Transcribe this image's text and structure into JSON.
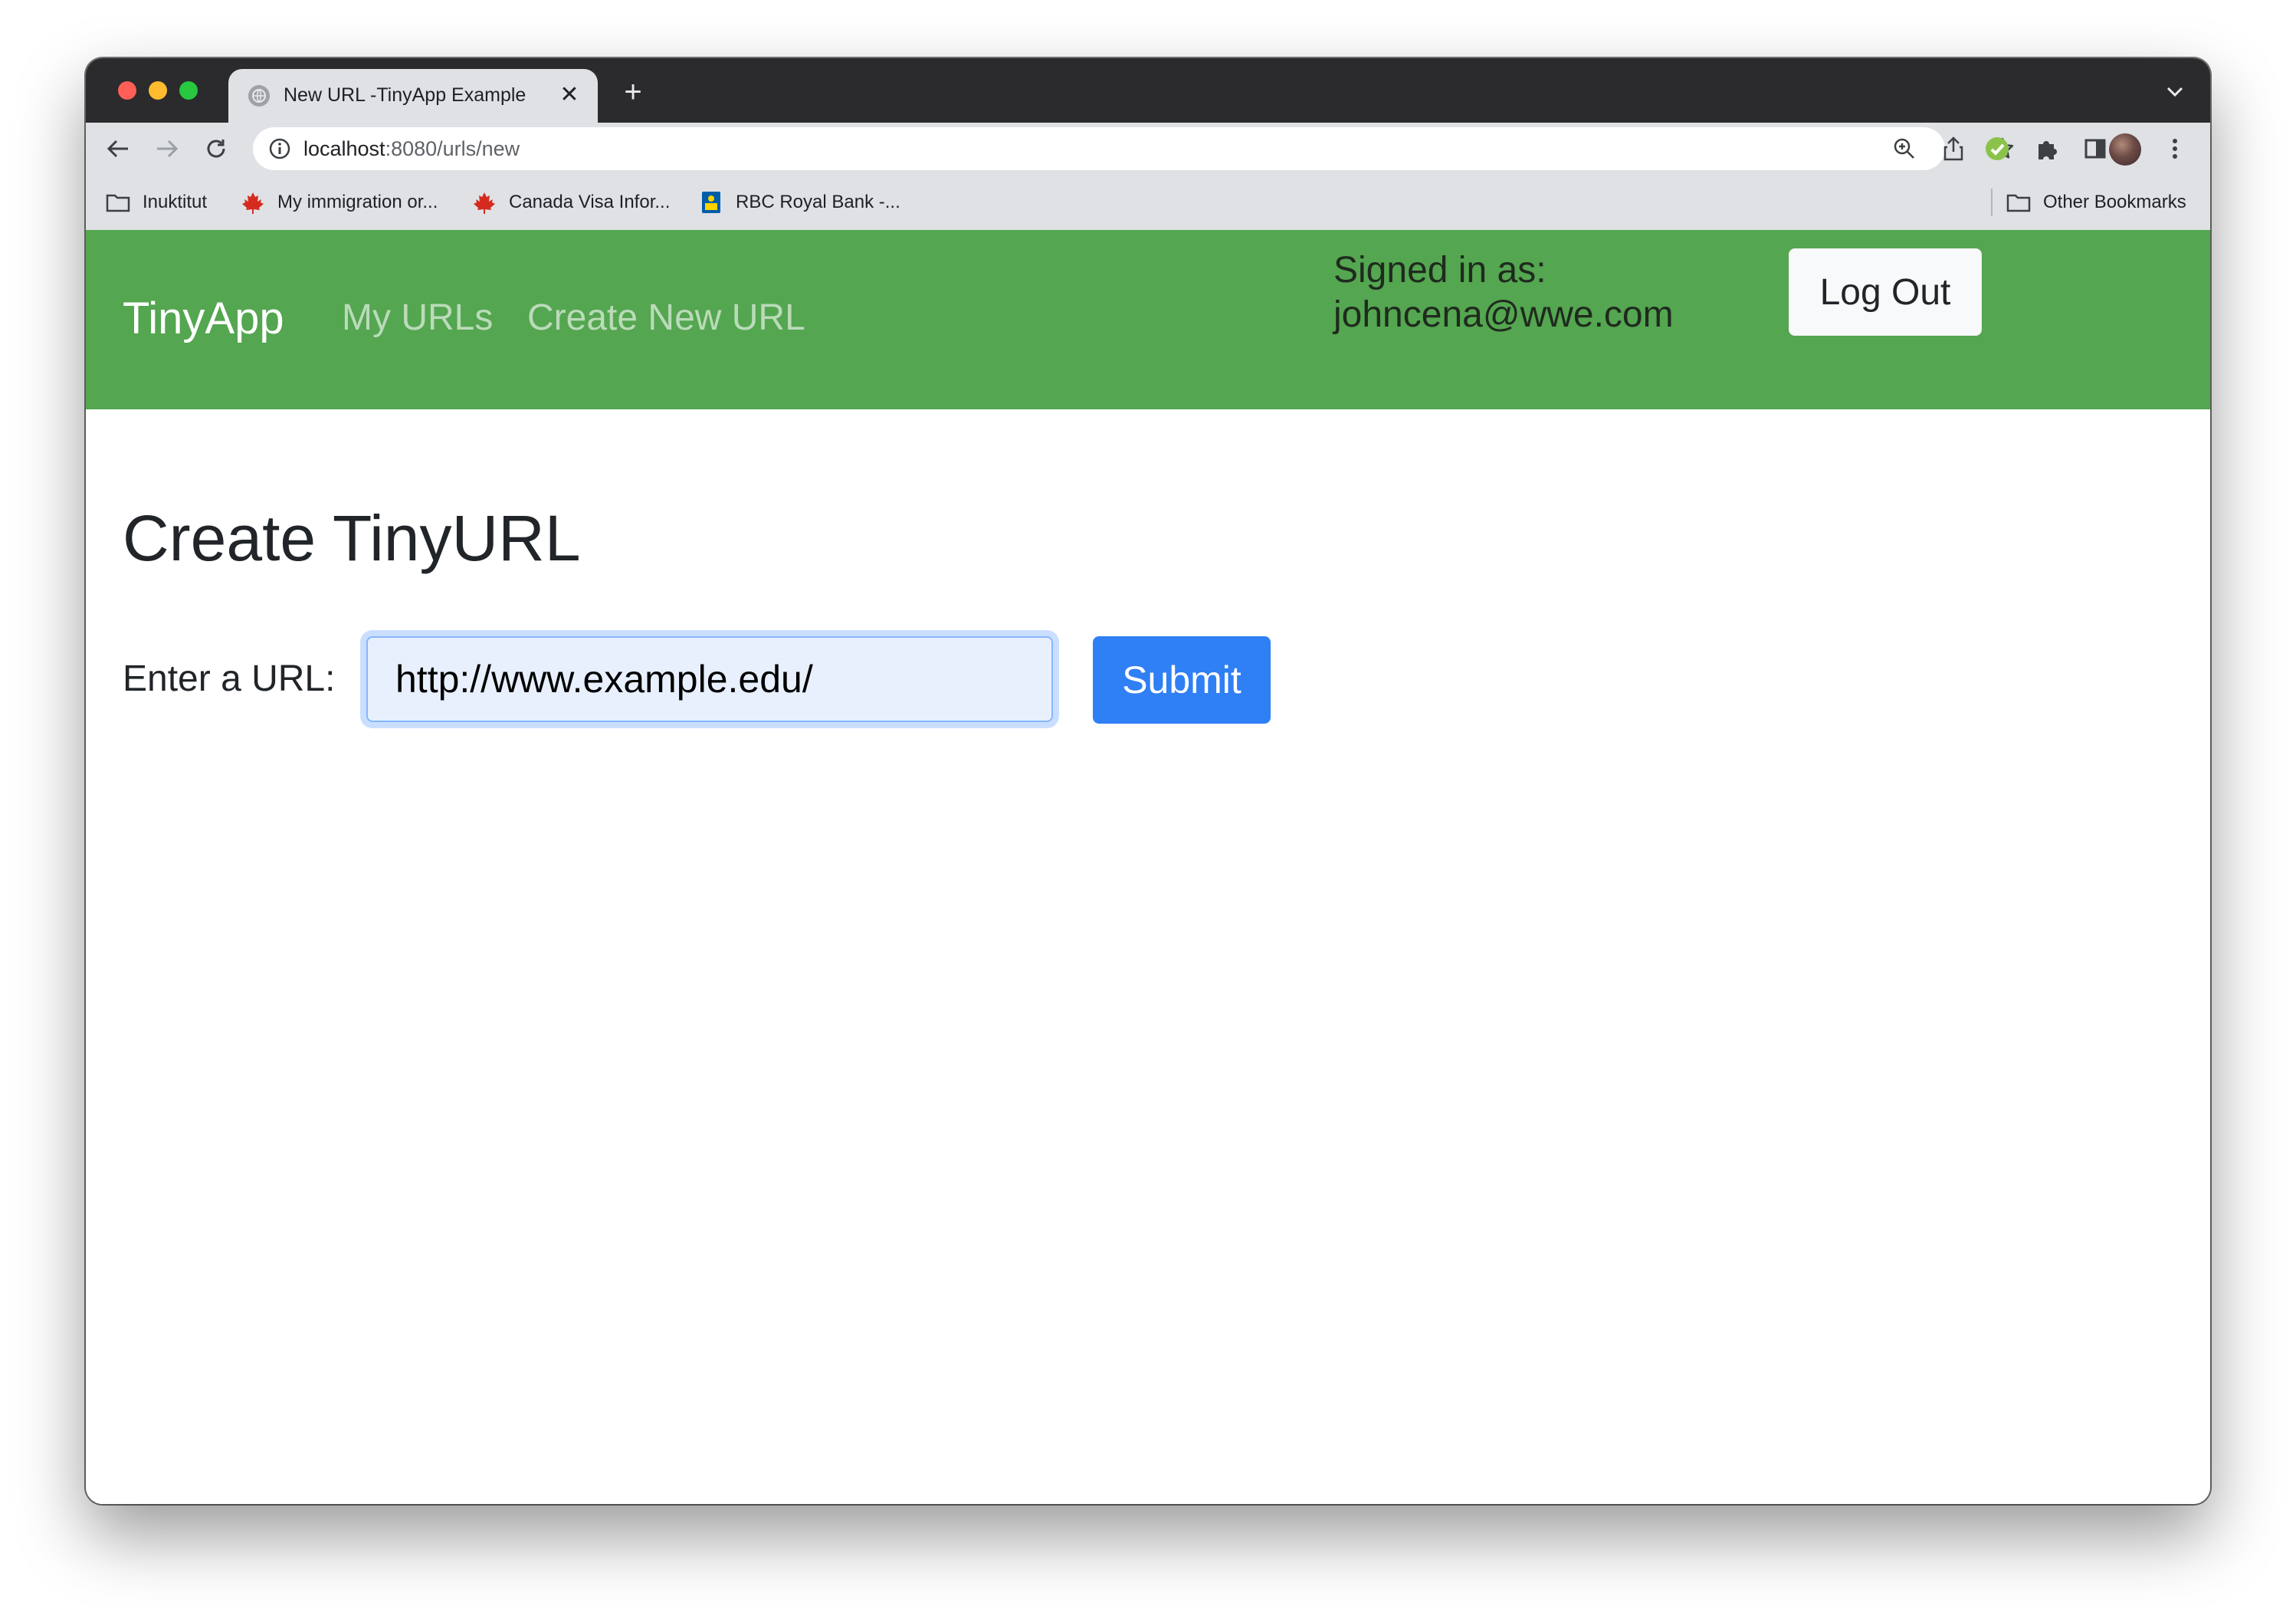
{
  "browser": {
    "tab": {
      "title": "New URL -TinyApp Example",
      "close": "✕"
    },
    "new_tab": "+",
    "address": {
      "host": "localhost",
      "path": ":8080/urls/new"
    },
    "bookmarks": [
      {
        "label": "Inuktitut",
        "icon": "folder-icon"
      },
      {
        "label": "My immigration or...",
        "icon": "maple-leaf-icon"
      },
      {
        "label": "Canada Visa Infor...",
        "icon": "maple-leaf-icon"
      },
      {
        "label": "RBC Royal Bank -...",
        "icon": "rbc-icon"
      }
    ],
    "other_bookmarks": "Other Bookmarks"
  },
  "navbar": {
    "brand": "TinyApp",
    "links": [
      "My URLs",
      "Create New URL"
    ],
    "signed_in_label": "Signed in as:",
    "email": "johncena@wwe.com",
    "logout": "Log Out",
    "color": "#54a650"
  },
  "main": {
    "title": "Create TinyURL",
    "label": "Enter a URL:",
    "input_value": "http://www.example.edu/",
    "submit": "Submit"
  },
  "colors": {
    "primary": "#2f7ff5",
    "input_bg": "#e8f0fe"
  }
}
